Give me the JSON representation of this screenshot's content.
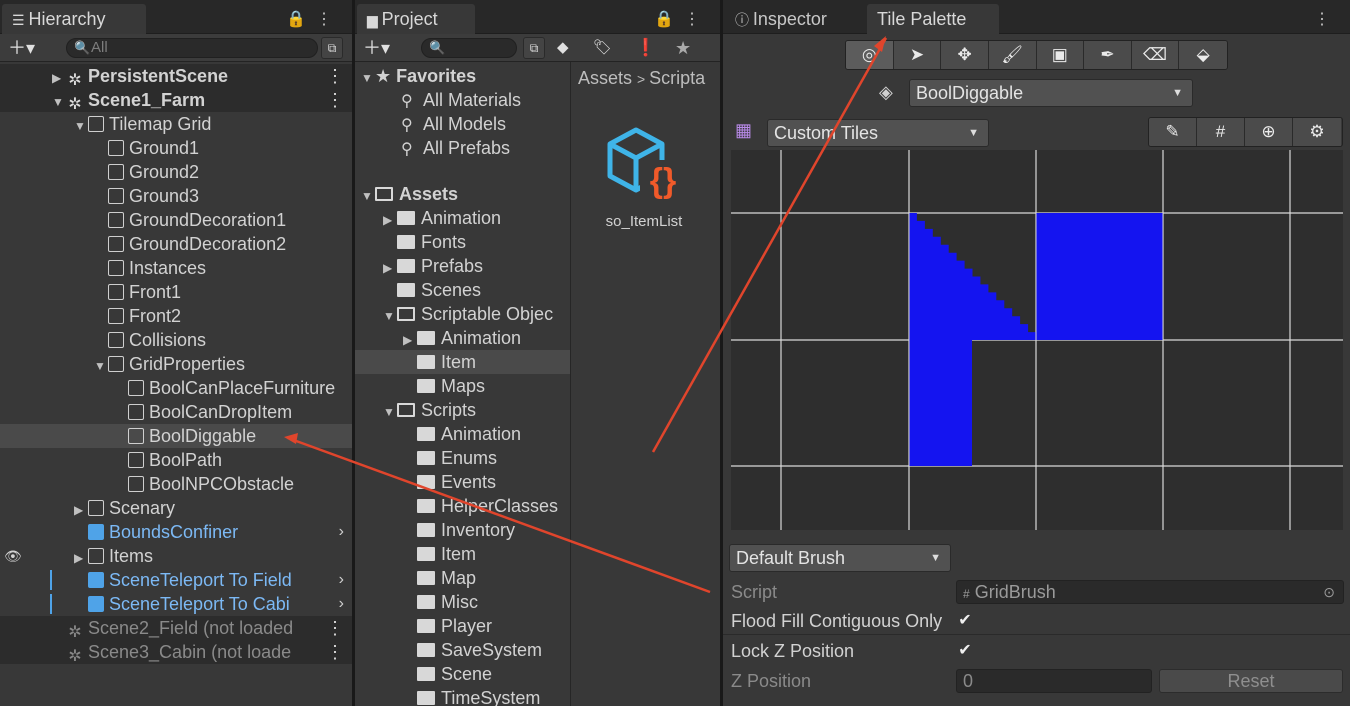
{
  "hierarchy": {
    "tab_label": "Hierarchy",
    "search_placeholder": "All",
    "items": [
      {
        "label": "PersistentScene",
        "depth": 0,
        "kind": "scene",
        "arrow": "▶"
      },
      {
        "label": "Scene1_Farm",
        "depth": 0,
        "kind": "scene",
        "arrow": "▼"
      },
      {
        "label": "Tilemap Grid",
        "depth": 1,
        "kind": "cube",
        "arrow": "▼"
      },
      {
        "label": "Ground1",
        "depth": 2,
        "kind": "cube",
        "arrow": ""
      },
      {
        "label": "Ground2",
        "depth": 2,
        "kind": "cube",
        "arrow": ""
      },
      {
        "label": "Ground3",
        "depth": 2,
        "kind": "cube",
        "arrow": ""
      },
      {
        "label": "GroundDecoration1",
        "depth": 2,
        "kind": "cube",
        "arrow": ""
      },
      {
        "label": "GroundDecoration2",
        "depth": 2,
        "kind": "cube",
        "arrow": ""
      },
      {
        "label": "Instances",
        "depth": 2,
        "kind": "cube",
        "arrow": ""
      },
      {
        "label": "Front1",
        "depth": 2,
        "kind": "cube",
        "arrow": ""
      },
      {
        "label": "Front2",
        "depth": 2,
        "kind": "cube",
        "arrow": ""
      },
      {
        "label": "Collisions",
        "depth": 2,
        "kind": "cube",
        "arrow": ""
      },
      {
        "label": "GridProperties",
        "depth": 2,
        "kind": "cube",
        "arrow": "▼"
      },
      {
        "label": "BoolCanPlaceFurniture",
        "depth": 3,
        "kind": "cube",
        "arrow": ""
      },
      {
        "label": "BoolCanDropItem",
        "depth": 3,
        "kind": "cube",
        "arrow": ""
      },
      {
        "label": "BoolDiggable",
        "depth": 3,
        "kind": "cube",
        "arrow": ""
      },
      {
        "label": "BoolPath",
        "depth": 3,
        "kind": "cube",
        "arrow": ""
      },
      {
        "label": "BoolNPCObstacle",
        "depth": 3,
        "kind": "cube",
        "arrow": ""
      },
      {
        "label": "Scenary",
        "depth": 1,
        "kind": "cube",
        "arrow": "▶"
      },
      {
        "label": "BoundsConfiner",
        "depth": 1,
        "kind": "bluecube",
        "arrow": ""
      },
      {
        "label": "Items",
        "depth": 1,
        "kind": "cube",
        "arrow": "▶"
      },
      {
        "label": "SceneTeleport To Field",
        "depth": 1,
        "kind": "bluecube",
        "arrow": ""
      },
      {
        "label": "SceneTeleport  To Cabi",
        "depth": 1,
        "kind": "bluecube",
        "arrow": ""
      },
      {
        "label": "Scene2_Field (not loaded",
        "depth": 0,
        "kind": "scene",
        "arrow": ""
      },
      {
        "label": "Scene3_Cabin (not loade",
        "depth": 0,
        "kind": "scene",
        "arrow": ""
      }
    ]
  },
  "project": {
    "tab_label": "Project",
    "breadcrumb": [
      "Assets",
      "Scripta"
    ],
    "favorites_label": "Favorites",
    "favorites": [
      "All Materials",
      "All Models",
      "All Prefabs"
    ],
    "assets_label": "Assets",
    "tree": [
      {
        "label": "Animation",
        "depth": 1,
        "arrow": "▶",
        "open": false
      },
      {
        "label": "Fonts",
        "depth": 1,
        "arrow": "",
        "open": false
      },
      {
        "label": "Prefabs",
        "depth": 1,
        "arrow": "▶",
        "open": false
      },
      {
        "label": "Scenes",
        "depth": 1,
        "arrow": "",
        "open": false
      },
      {
        "label": "Scriptable Objec",
        "depth": 1,
        "arrow": "▼",
        "open": true
      },
      {
        "label": "Animation",
        "depth": 2,
        "arrow": "▶",
        "open": false
      },
      {
        "label": "Item",
        "depth": 2,
        "arrow": "",
        "open": false
      },
      {
        "label": "Maps",
        "depth": 2,
        "arrow": "",
        "open": false
      },
      {
        "label": "Scripts",
        "depth": 1,
        "arrow": "▼",
        "open": true
      },
      {
        "label": "Animation",
        "depth": 2,
        "arrow": "",
        "open": false
      },
      {
        "label": "Enums",
        "depth": 2,
        "arrow": "",
        "open": false
      },
      {
        "label": "Events",
        "depth": 2,
        "arrow": "",
        "open": false
      },
      {
        "label": "HelperClasses",
        "depth": 2,
        "arrow": "",
        "open": false
      },
      {
        "label": "Inventory",
        "depth": 2,
        "arrow": "",
        "open": false
      },
      {
        "label": "Item",
        "depth": 2,
        "arrow": "",
        "open": false
      },
      {
        "label": "Map",
        "depth": 2,
        "arrow": "",
        "open": false
      },
      {
        "label": "Misc",
        "depth": 2,
        "arrow": "",
        "open": false
      },
      {
        "label": "Player",
        "depth": 2,
        "arrow": "",
        "open": false
      },
      {
        "label": "SaveSystem",
        "depth": 2,
        "arrow": "",
        "open": false
      },
      {
        "label": "Scene",
        "depth": 2,
        "arrow": "",
        "open": false
      },
      {
        "label": "TimeSystem",
        "depth": 2,
        "arrow": "",
        "open": false
      }
    ],
    "asset_name": "so_ItemList",
    "asset_glyph": "{}"
  },
  "inspector_tab": "Inspector",
  "palette": {
    "tab_label": "Tile Palette",
    "tools": [
      "select-icon",
      "move-icon",
      "paint-brush-icon",
      "box-fill-icon",
      "picker-icon",
      "eraser-icon",
      "bucket-icon"
    ],
    "active_tilemap": "BoolDiggable",
    "palette_name": "Custom Tiles",
    "brush": "Default Brush",
    "props": {
      "script_label": "Script",
      "script_value": "GridBrush",
      "flood_label": "Flood Fill Contiguous Only",
      "lock_label": "Lock Z Position",
      "z_label": "Z Position",
      "z_value": "0",
      "reset_label": "Reset"
    },
    "tile_color": "#1414f0",
    "arrow_color": "#e0452c"
  }
}
